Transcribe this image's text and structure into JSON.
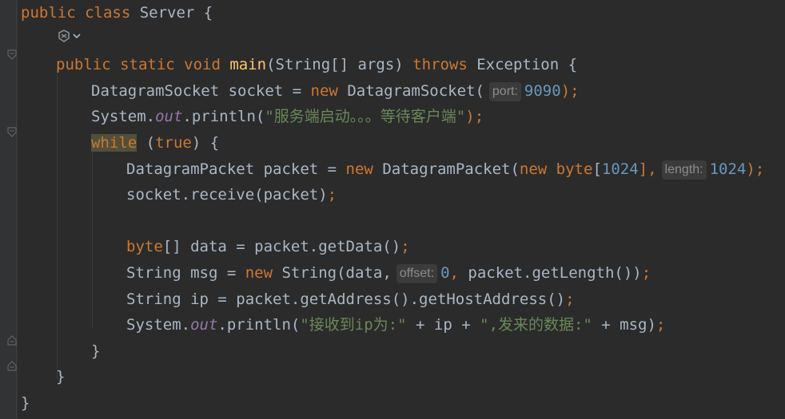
{
  "editor": {
    "lines": [
      {
        "indent": 0,
        "tokens": [
          {
            "t": "public class ",
            "c": "kw"
          },
          {
            "t": "Server {",
            "c": ""
          }
        ]
      },
      {
        "indent": 1,
        "ai_icon": true,
        "tokens": []
      },
      {
        "indent": 1,
        "tokens": [
          {
            "t": "public static void ",
            "c": "kw"
          },
          {
            "t": "main",
            "c": "fn"
          },
          {
            "t": "(String[] args) ",
            "c": ""
          },
          {
            "t": "throws ",
            "c": "kw"
          },
          {
            "t": "Exception {",
            "c": ""
          }
        ]
      },
      {
        "indent": 2,
        "tokens": [
          {
            "t": "DatagramSocket socket = ",
            "c": ""
          },
          {
            "t": "new ",
            "c": "kw"
          },
          {
            "t": "DatagramSocket(",
            "c": ""
          },
          {
            "t": "port:",
            "c": "hint"
          },
          {
            "t": "9090",
            "c": "num"
          },
          {
            "t": ");",
            "c": "kw"
          }
        ]
      },
      {
        "indent": 2,
        "tokens": [
          {
            "t": "System.",
            "c": ""
          },
          {
            "t": "out",
            "c": "fld"
          },
          {
            "t": ".println(",
            "c": ""
          },
          {
            "t": "\"服务端启动。。。等待客户端\"",
            "c": "str"
          },
          {
            "t": ");",
            "c": "kw"
          }
        ]
      },
      {
        "indent": 2,
        "tokens": [
          {
            "t": "while",
            "c": "kw hl"
          },
          {
            "t": " (",
            "c": ""
          },
          {
            "t": "true",
            "c": "kw"
          },
          {
            "t": ") {",
            "c": ""
          }
        ]
      },
      {
        "indent": 3,
        "tokens": [
          {
            "t": "DatagramPacket packet = ",
            "c": ""
          },
          {
            "t": "new ",
            "c": "kw"
          },
          {
            "t": "DatagramPacket(",
            "c": ""
          },
          {
            "t": "new ",
            "c": "kw"
          },
          {
            "t": "byte",
            "c": "kw"
          },
          {
            "t": "[",
            "c": ""
          },
          {
            "t": "1024",
            "c": "num"
          },
          {
            "t": "],",
            "c": "kw"
          },
          {
            "t": "length:",
            "c": "hint"
          },
          {
            "t": "1024",
            "c": "num"
          },
          {
            "t": ");",
            "c": "kw"
          }
        ]
      },
      {
        "indent": 3,
        "tokens": [
          {
            "t": "socket.receive(packet)",
            "c": ""
          },
          {
            "t": ";",
            "c": "kw"
          }
        ]
      },
      {
        "indent": 3,
        "tokens": []
      },
      {
        "indent": 3,
        "tokens": [
          {
            "t": "byte",
            "c": "kw"
          },
          {
            "t": "[] data = packet.getData()",
            "c": ""
          },
          {
            "t": ";",
            "c": "kw"
          }
        ]
      },
      {
        "indent": 3,
        "tokens": [
          {
            "t": "String msg = ",
            "c": ""
          },
          {
            "t": "new ",
            "c": "kw"
          },
          {
            "t": "String(data,",
            "c": ""
          },
          {
            "t": "offset:",
            "c": "hint"
          },
          {
            "t": "0",
            "c": "num"
          },
          {
            "t": ", ",
            "c": "kw"
          },
          {
            "t": "packet.getLength())",
            "c": ""
          },
          {
            "t": ";",
            "c": "kw"
          }
        ]
      },
      {
        "indent": 3,
        "tokens": [
          {
            "t": "String ip = packet.getAddress().getHostAddress()",
            "c": ""
          },
          {
            "t": ";",
            "c": "kw"
          }
        ]
      },
      {
        "indent": 3,
        "tokens": [
          {
            "t": "System.",
            "c": ""
          },
          {
            "t": "out",
            "c": "fld"
          },
          {
            "t": ".println(",
            "c": ""
          },
          {
            "t": "\"接收到ip为:\"",
            "c": "str"
          },
          {
            "t": " + ip + ",
            "c": ""
          },
          {
            "t": "\",发来的数据:\"",
            "c": "str"
          },
          {
            "t": " + msg)",
            "c": ""
          },
          {
            "t": ";",
            "c": "kw"
          }
        ]
      },
      {
        "indent": 2,
        "tokens": [
          {
            "t": "}",
            "c": ""
          }
        ]
      },
      {
        "indent": 1,
        "tokens": [
          {
            "t": "}",
            "c": ""
          }
        ]
      },
      {
        "indent": 0,
        "tokens": [
          {
            "t": "}",
            "c": ""
          }
        ]
      }
    ]
  }
}
